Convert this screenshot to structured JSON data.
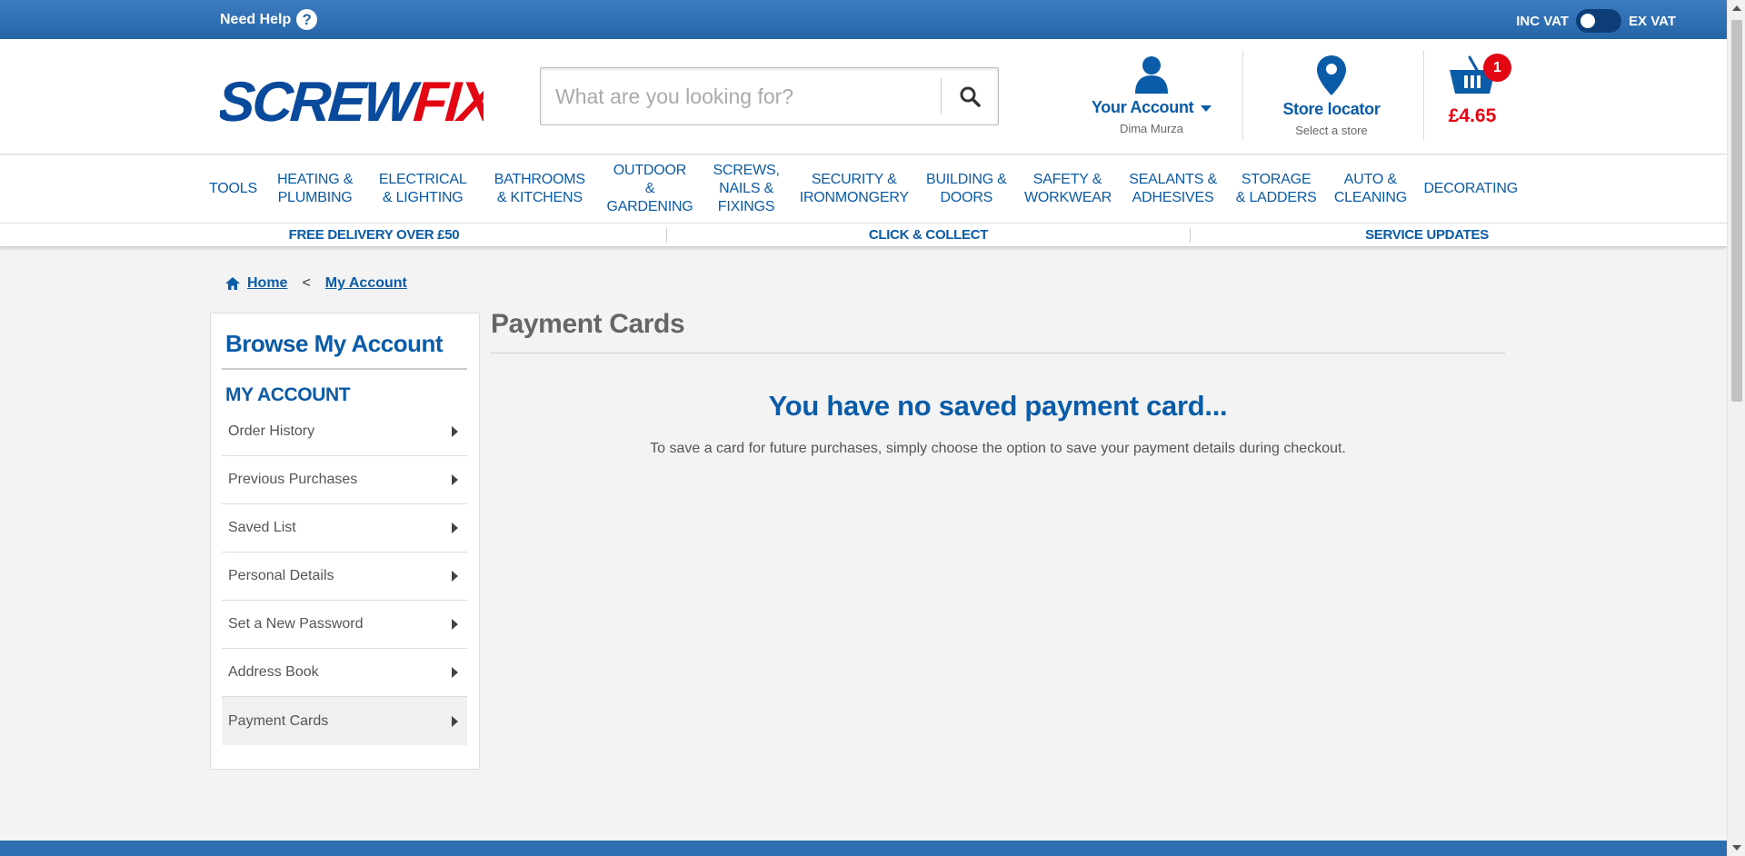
{
  "topbar": {
    "need_help": "Need Help",
    "help_icon": "?",
    "inc_vat": "INC VAT",
    "ex_vat": "EX VAT"
  },
  "header": {
    "logo_text": "SCREWFIX",
    "search_placeholder": "What are you looking for?",
    "account": {
      "title": "Your Account",
      "user": "Dima Murza"
    },
    "store": {
      "title": "Store locator",
      "sub": "Select a store"
    },
    "basket": {
      "count": "1",
      "total": "£4.65"
    }
  },
  "nav": {
    "items": [
      {
        "label": "TOOLS"
      },
      {
        "label": "HEATING & PLUMBING"
      },
      {
        "label": "ELECTRICAL & LIGHTING"
      },
      {
        "label": "BATHROOMS & KITCHENS"
      },
      {
        "label": "OUTDOOR & GARDENING"
      },
      {
        "label": "SCREWS, NAILS & FIXINGS"
      },
      {
        "label": "SECURITY & IRONMONGERY"
      },
      {
        "label": "BUILDING & DOORS"
      },
      {
        "label": "SAFETY & WORKWEAR"
      },
      {
        "label": "SEALANTS & ADHESIVES"
      },
      {
        "label": "STORAGE & LADDERS"
      },
      {
        "label": "AUTO & CLEANING"
      },
      {
        "label": "DECORATING"
      }
    ]
  },
  "strip": {
    "delivery": "FREE DELIVERY OVER £50",
    "click_collect": "CLICK & COLLECT",
    "service": "SERVICE UPDATES"
  },
  "breadcrumb": {
    "home": "Home",
    "sep": "<",
    "current": "My Account"
  },
  "sidebar": {
    "title": "Browse My Account",
    "heading": "MY ACCOUNT",
    "items": [
      {
        "label": "Order History"
      },
      {
        "label": "Previous Purchases"
      },
      {
        "label": "Saved List"
      },
      {
        "label": "Personal Details"
      },
      {
        "label": "Set a New Password"
      },
      {
        "label": "Address Book"
      },
      {
        "label": "Payment Cards"
      }
    ]
  },
  "main": {
    "title": "Payment Cards",
    "empty_heading": "You have no saved payment card...",
    "empty_text": "To save a card for future purchases, simply choose the option to save your payment details during checkout."
  },
  "colors": {
    "brand_blue": "#0a5ba8",
    "topbar_blue": "#2465a8",
    "basket_red": "#e30613"
  }
}
